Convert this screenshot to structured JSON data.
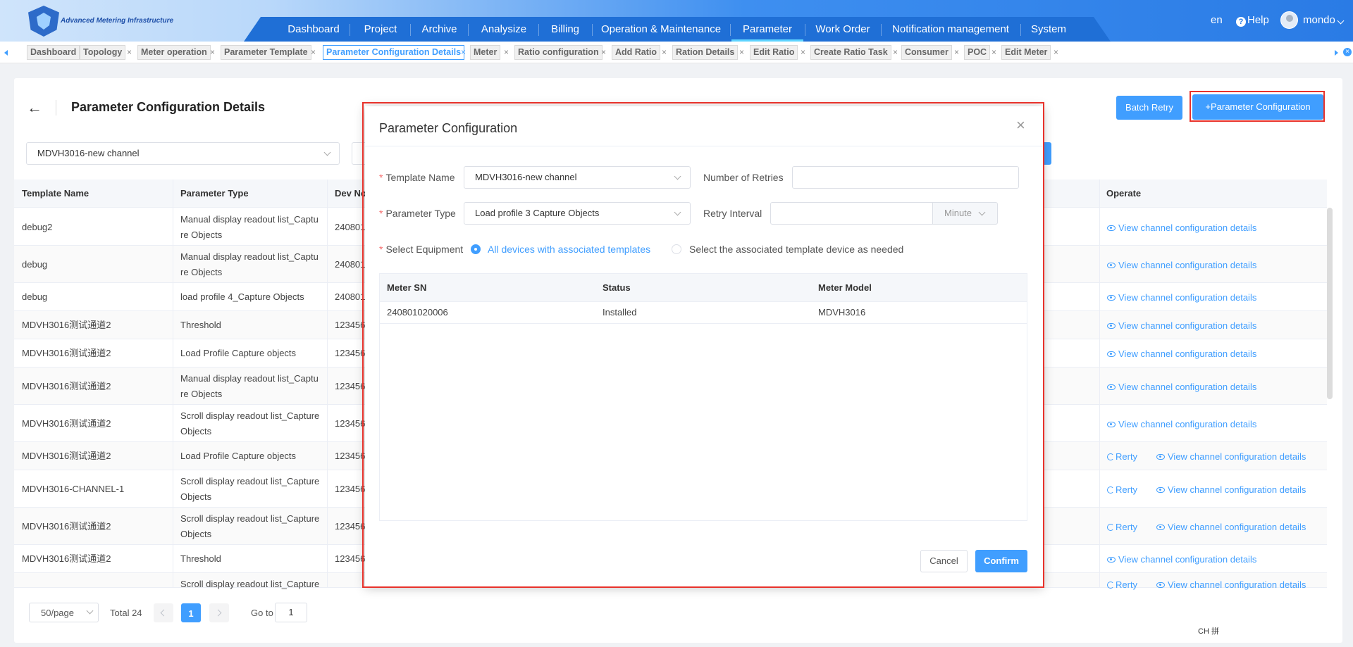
{
  "header": {
    "app_name": "Advanced Metering Infrastructure",
    "nav": [
      "Dashboard",
      "Project",
      "Archive",
      "Analysize",
      "Billing",
      "Operation & Maintenance",
      "Parameter",
      "Work Order",
      "Notification management",
      "System"
    ],
    "active_nav": "Parameter",
    "lang": "en",
    "help": "Help",
    "user": "mondo"
  },
  "tabs": [
    "Dashboard",
    "Topology",
    "Meter operation",
    "Parameter Template",
    "Parameter Configuration Details",
    "Meter",
    "Ratio configuration",
    "Add Ratio",
    "Ration Details",
    "Edit Ratio",
    "Create Ratio Task",
    "Consumer",
    "POC",
    "Edit Meter"
  ],
  "active_tab": "Parameter Configuration Details",
  "page": {
    "title": "Parameter Configuration Details",
    "back": "←",
    "batch_retry": "Batch Retry",
    "add_config": "+Parameter Configuration",
    "filter_template": "MDVH3016-new channel"
  },
  "table": {
    "headers": [
      "Template Name",
      "Parameter Type",
      "Dev No",
      "Operate"
    ],
    "retry_label": "Rerty",
    "view_label": "View channel configuration details",
    "rows": [
      {
        "name": "debug2",
        "type1": "Manual display readout list_Captu",
        "type2": "re Objects",
        "dev": "240801",
        "retry": false
      },
      {
        "name": "debug",
        "type1": "Manual display readout list_Captu",
        "type2": "re Objects",
        "dev": "240801",
        "retry": false
      },
      {
        "name": "debug",
        "type1": "load profile 4_Capture Objects",
        "type2": "",
        "dev": "240801",
        "retry": false
      },
      {
        "name": "MDVH3016测试通道2",
        "type1": "Threshold",
        "type2": "",
        "dev": "123456",
        "retry": false
      },
      {
        "name": "MDVH3016测试通道2",
        "type1": "Load Profile Capture objects",
        "type2": "",
        "dev": "123456",
        "retry": false
      },
      {
        "name": "MDVH3016测试通道2",
        "type1": "Manual display readout list_Captu",
        "type2": "re Objects",
        "dev": "123456",
        "retry": false
      },
      {
        "name": "MDVH3016测试通道2",
        "type1": "Scroll display readout list_Capture",
        "type2": "Objects",
        "dev": "123456",
        "retry": false
      },
      {
        "name": "MDVH3016测试通道2",
        "type1": "Load Profile Capture objects",
        "type2": "",
        "dev": "123456",
        "retry": true
      },
      {
        "name": "MDVH3016-CHANNEL-1",
        "type1": "Scroll display readout list_Capture",
        "type2": "Objects",
        "dev": "123456",
        "retry": true
      },
      {
        "name": "MDVH3016测试通道2",
        "type1": "Scroll display readout list_Capture",
        "type2": "Objects",
        "dev": "123456",
        "retry": true
      },
      {
        "name": "MDVH3016测试通道2",
        "type1": "Threshold",
        "type2": "",
        "dev": "123456",
        "retry": false
      },
      {
        "name": "",
        "type1": "Scroll display readout list_Capture",
        "type2": "",
        "dev": "",
        "retry": true
      }
    ]
  },
  "pagination": {
    "page_size": "50/page",
    "total": "Total 24",
    "current": "1",
    "goto_label": "Go to",
    "goto_value": "1"
  },
  "dialog": {
    "title": "Parameter Configuration",
    "template_label": "Template Name",
    "template_value": "MDVH3016-new channel",
    "retries_label": "Number of Retries",
    "retries_value": "",
    "param_type_label": "Parameter Type",
    "param_type_value": "Load profile 3 Capture Objects",
    "interval_label": "Retry Interval",
    "interval_value": "",
    "interval_unit": "Minute",
    "equip_label": "Select Equipment",
    "option_all": "All devices with associated templates",
    "option_select": "Select the associated template device as needed",
    "table_headers": [
      "Meter SN",
      "Status",
      "Meter Model"
    ],
    "table_rows": [
      {
        "sn": "240801020006",
        "status": "Installed",
        "model": "MDVH3016"
      }
    ],
    "cancel": "Cancel",
    "confirm": "Confirm"
  },
  "ime": "CH 拼"
}
